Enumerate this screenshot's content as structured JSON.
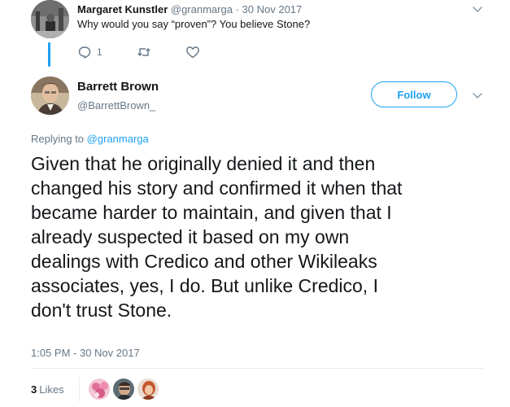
{
  "parent_tweet": {
    "name": "Margaret Kunstler",
    "handle": "@granmarga",
    "separator": "·",
    "date": "30 Nov 2017",
    "text": "Why would you say “proven”? You believe Stone?",
    "reply_count": "1",
    "icons": [
      "reply-icon",
      "retweet-icon",
      "like-icon",
      "chevron-down-icon"
    ]
  },
  "tweet": {
    "name": "Barrett Brown",
    "handle": "@BarrettBrown_",
    "follow_label": "Follow",
    "replying_prefix": "Replying to",
    "replying_mention": "@granmarga",
    "text": "Given that he originally denied it and then\nchanged his story and confirmed it when that\nbecame harder to maintain, and given that I\nalready suspected it based on my own\ndealings with Credico and other Wikileaks\nassociates, yes, I do. But unlike Credico, I\ndon't trust Stone.",
    "timestamp": "1:05 PM - 30 Nov 2017",
    "likes_count": "3",
    "likes_label": "Likes"
  },
  "colors": {
    "accent": "#1da1f2",
    "secondary_text": "#657786",
    "primary_text": "#14171a",
    "divider": "#e6ecf0"
  }
}
